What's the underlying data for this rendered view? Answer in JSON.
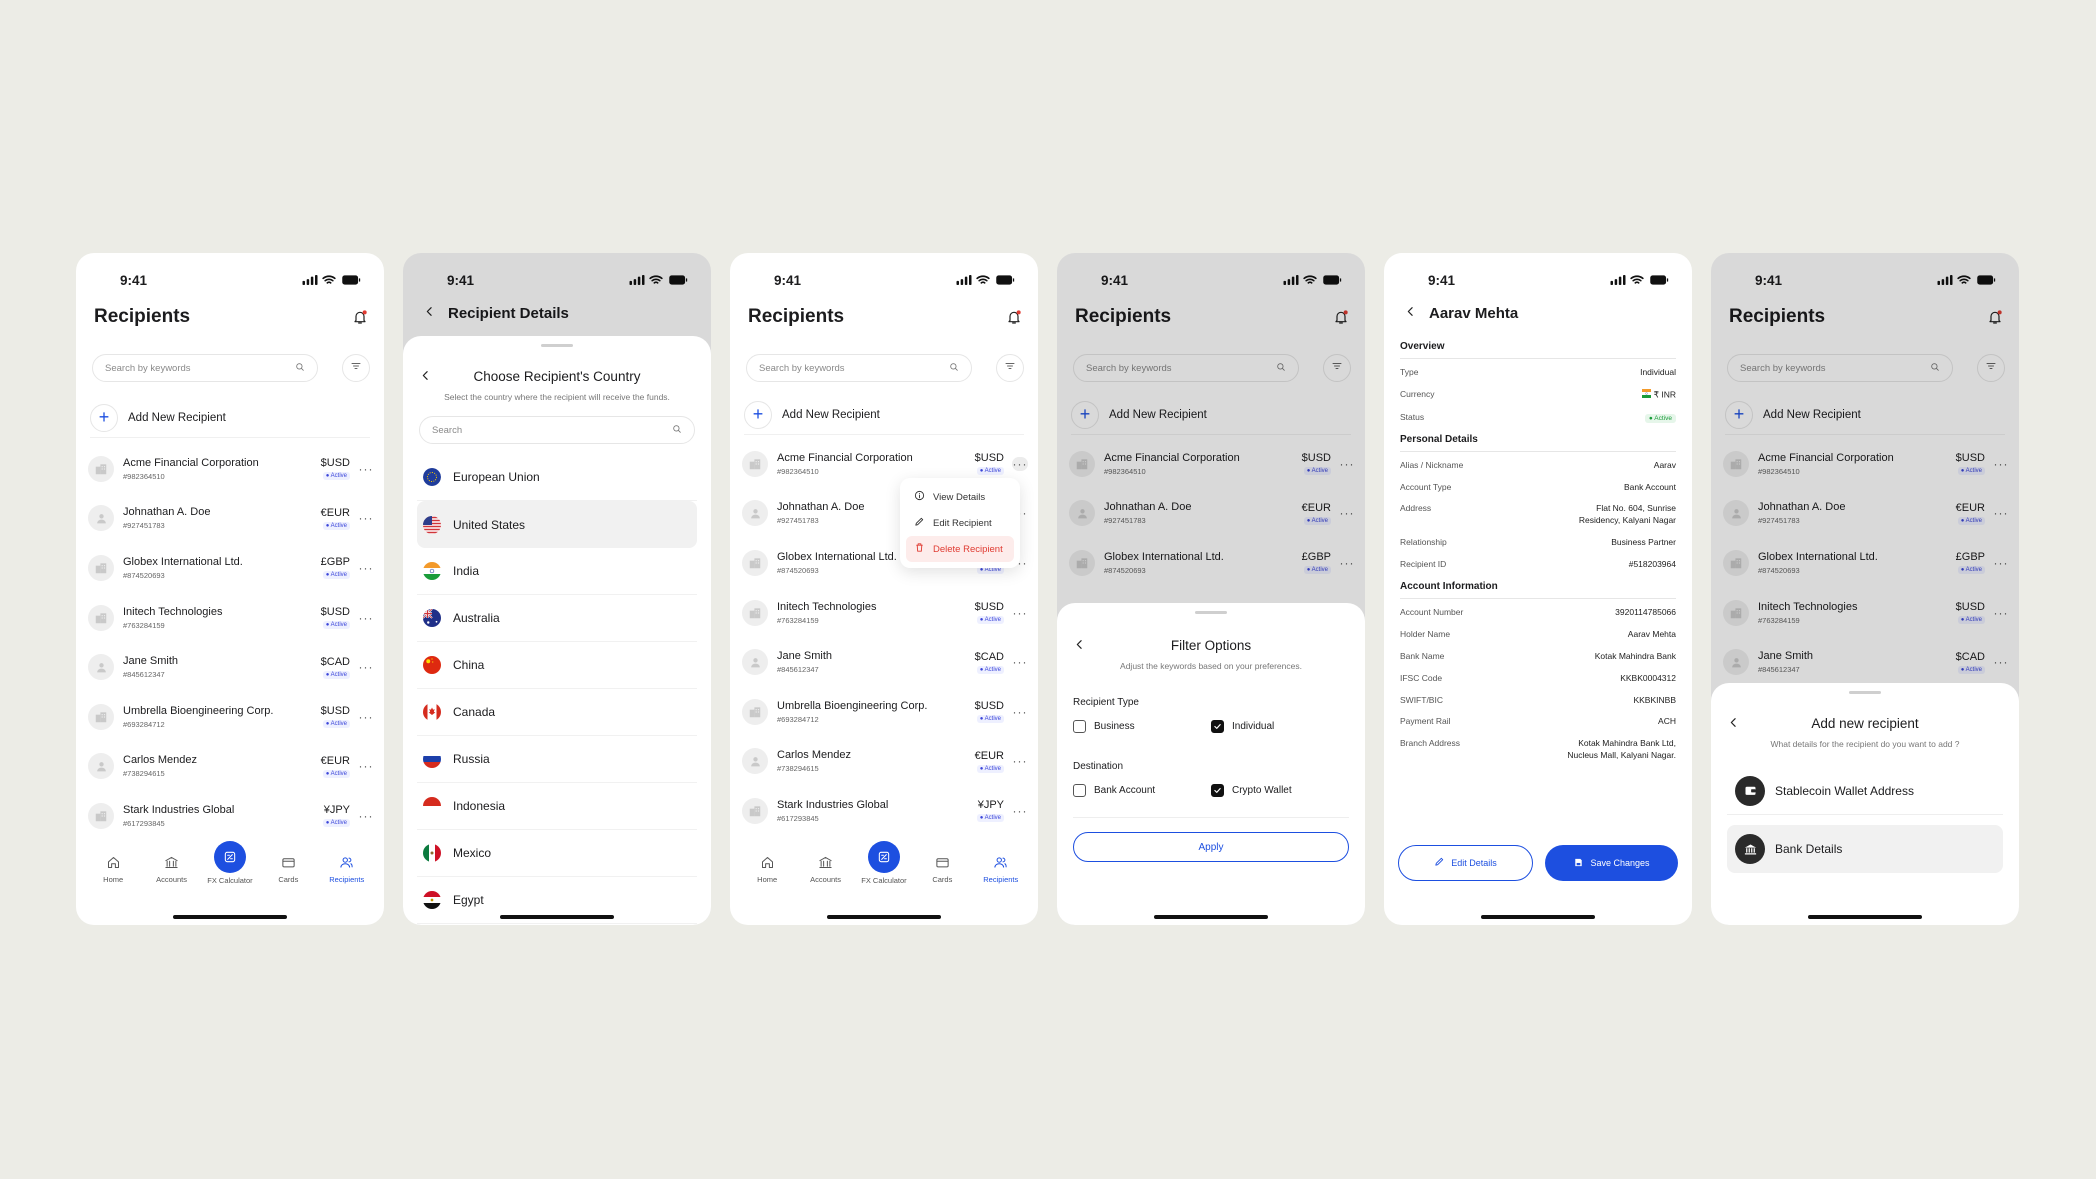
{
  "status_time": "9:41",
  "colors": {
    "accent": "#1d4fe0",
    "danger": "#e03b32",
    "active_badge": "#3b45d9"
  },
  "recipients_screen": {
    "title": "Recipients",
    "search_placeholder": "Search by keywords",
    "add_new": "Add New Recipient",
    "recipients": [
      {
        "name": "Acme Financial Corporation",
        "id": "#982364510",
        "currency": "$USD",
        "status": "Active",
        "icon": "building-icon"
      },
      {
        "name": "Johnathan A. Doe",
        "id": "#927451783",
        "currency": "€EUR",
        "status": "Active",
        "icon": "person-icon"
      },
      {
        "name": "Globex International Ltd.",
        "id": "#874520693",
        "currency": "£GBP",
        "status": "Active",
        "icon": "building-icon"
      },
      {
        "name": "Initech Technologies",
        "id": "#763284159",
        "currency": "$USD",
        "status": "Active",
        "icon": "building-icon"
      },
      {
        "name": "Jane Smith",
        "id": "#845612347",
        "currency": "$CAD",
        "status": "Active",
        "icon": "person-icon"
      },
      {
        "name": "Umbrella Bioengineering Corp.",
        "id": "#693284712",
        "currency": "$USD",
        "status": "Active",
        "icon": "building-icon"
      },
      {
        "name": "Carlos Mendez",
        "id": "#738294615",
        "currency": "€EUR",
        "status": "Active",
        "icon": "person-icon"
      },
      {
        "name": "Stark Industries Global",
        "id": "#617293845",
        "currency": "¥JPY",
        "status": "Active",
        "icon": "building-icon"
      }
    ],
    "tabs": [
      "Home",
      "Accounts",
      "FX Calculator",
      "Cards",
      "Recipients"
    ],
    "active_tab": "Recipients"
  },
  "country_screen": {
    "header": "Recipient Details",
    "sheet_title": "Choose Recipient's Country",
    "sheet_subtitle": "Select the country where the recipient will receive the funds.",
    "search_placeholder": "Search",
    "countries": [
      "European Union",
      "United States",
      "India",
      "Australia",
      "China",
      "Canada",
      "Russia",
      "Indonesia",
      "Mexico",
      "Egypt"
    ],
    "selected": "United States"
  },
  "context_menu": {
    "items": [
      "View Details",
      "Edit Recipient",
      "Delete Recipient"
    ]
  },
  "filter_sheet": {
    "title": "Filter Options",
    "subtitle": "Adjust the keywords based on your preferences.",
    "recipient_type_label": "Recipient Type",
    "type_options": [
      {
        "label": "Business",
        "checked": false
      },
      {
        "label": "Individual",
        "checked": true
      }
    ],
    "destination_label": "Destination",
    "destination_options": [
      {
        "label": "Bank Account",
        "checked": false
      },
      {
        "label": "Crypto Wallet",
        "checked": true
      }
    ],
    "apply": "Apply"
  },
  "detail_screen": {
    "header": "Aarav Mehta",
    "overview_title": "Overview",
    "overview": [
      {
        "k": "Type",
        "v": "Individual"
      },
      {
        "k": "Currency",
        "v": "₹ INR"
      },
      {
        "k": "Status",
        "v": "Active"
      }
    ],
    "personal_title": "Personal Details",
    "personal": [
      {
        "k": "Alias / Nickname",
        "v": "Aarav"
      },
      {
        "k": "Account Type",
        "v": "Bank Account"
      },
      {
        "k": "Address",
        "v": "Flat No. 604, Sunrise",
        "v2": "Residency, Kalyani Nagar"
      },
      {
        "k": "Relationship",
        "v": "Business Partner"
      },
      {
        "k": "Recipient ID",
        "v": "#518203964"
      }
    ],
    "account_title": "Account Information",
    "account": [
      {
        "k": "Account Number",
        "v": "3920114785066"
      },
      {
        "k": "Holder Name",
        "v": "Aarav Mehta"
      },
      {
        "k": "Bank Name",
        "v": "Kotak Mahindra Bank"
      },
      {
        "k": "IFSC Code",
        "v": "KKBK0004312"
      },
      {
        "k": "SWIFT/BIC",
        "v": "KKBKINBB"
      },
      {
        "k": "Payment Rail",
        "v": "ACH"
      },
      {
        "k": "Branch Address",
        "v": "Kotak Mahindra Bank Ltd,",
        "v2": "Nucleus Mall, Kalyani Nagar."
      }
    ],
    "edit_button": "Edit Details",
    "save_button": "Save Changes"
  },
  "add_sheet": {
    "title": "Add new recipient",
    "subtitle": "What details for the recipient do you want to add ?",
    "options": [
      "Stablecoin Wallet Address",
      "Bank Details"
    ],
    "selected": "Bank Details"
  }
}
